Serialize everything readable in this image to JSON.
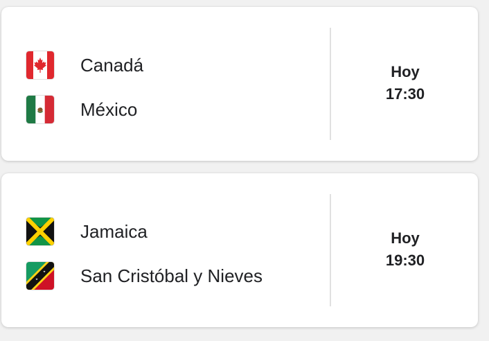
{
  "matches": [
    {
      "home": {
        "name": "Canadá",
        "flag_icon": "canada-flag-icon"
      },
      "away": {
        "name": "México",
        "flag_icon": "mexico-flag-icon"
      },
      "day": "Hoy",
      "time": "17:30"
    },
    {
      "home": {
        "name": "Jamaica",
        "flag_icon": "jamaica-flag-icon"
      },
      "away": {
        "name": "San Cristóbal y Nieves",
        "flag_icon": "saint-kitts-nevis-flag-icon"
      },
      "day": "Hoy",
      "time": "19:30"
    }
  ],
  "colors": {
    "page_background": "#f1f1f1",
    "card_background": "#ffffff",
    "text": "#202124",
    "divider": "#e0e0e0"
  }
}
